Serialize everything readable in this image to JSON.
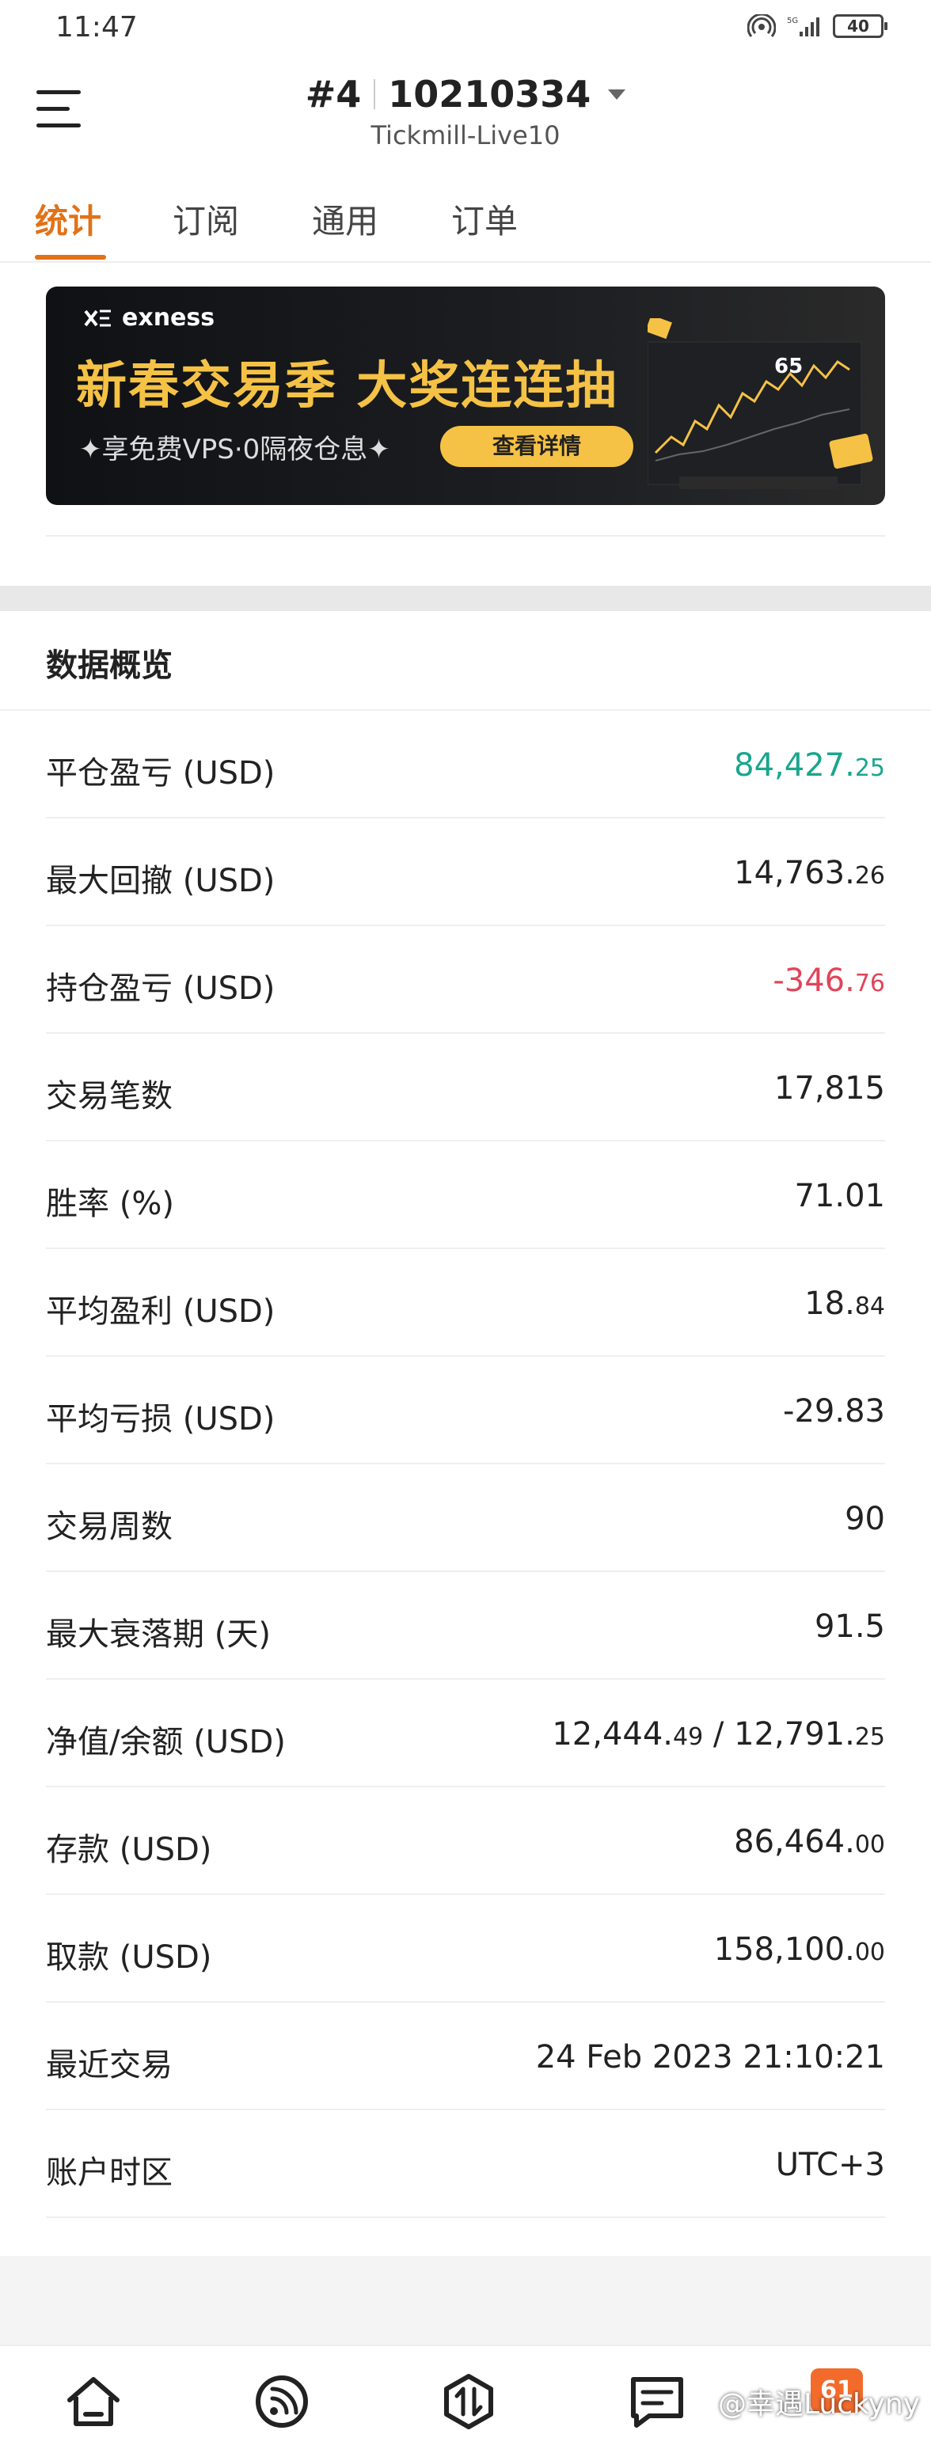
{
  "status_bar": {
    "time": "11:47",
    "battery": "40"
  },
  "header": {
    "account_prefix": "#4",
    "account_number": "10210334",
    "server": "Tickmill-Live10"
  },
  "tabs": [
    {
      "label": "统计",
      "active": true
    },
    {
      "label": "订阅",
      "active": false
    },
    {
      "label": "通用",
      "active": false
    },
    {
      "label": "订单",
      "active": false
    }
  ],
  "banner": {
    "brand": "exness",
    "title": "新春交易季 大奖连连抽",
    "subtitle": "✦享免费VPS·0隔夜仓息✦",
    "button": "查看详情",
    "badge_number": "65"
  },
  "overview": {
    "title": "数据概览",
    "rows": [
      {
        "label": "平仓盈亏 (USD)",
        "int": "84,427.",
        "dec": "25",
        "tone": "pos"
      },
      {
        "label": "最大回撤 (USD)",
        "int": "14,763.",
        "dec": "26",
        "tone": ""
      },
      {
        "label": "持仓盈亏 (USD)",
        "int": "-346.",
        "dec": "76",
        "tone": "neg"
      },
      {
        "label": "交易笔数",
        "int": "17,815",
        "dec": "",
        "tone": ""
      },
      {
        "label": "胜率 (%)",
        "int": "71.01",
        "dec": "",
        "tone": ""
      },
      {
        "label": "平均盈利 (USD)",
        "int": "18.",
        "dec": "84",
        "tone": ""
      },
      {
        "label": "平均亏损 (USD)",
        "int": "-29.83",
        "dec": "",
        "tone": ""
      },
      {
        "label": "交易周数",
        "int": "90",
        "dec": "",
        "tone": ""
      },
      {
        "label": "最大衰落期 (天)",
        "int": "91.5",
        "dec": "",
        "tone": ""
      },
      {
        "label": "净值/余额 (USD)",
        "int": "12,444.",
        "dec": "49",
        "int2": " / 12,791.",
        "dec2": "25",
        "tone": ""
      },
      {
        "label": "存款 (USD)",
        "int": "86,464.",
        "dec": "00",
        "tone": ""
      },
      {
        "label": "取款 (USD)",
        "int": "158,100.",
        "dec": "00",
        "tone": ""
      },
      {
        "label": "最近交易",
        "int": "24 Feb 2023 21:10:21",
        "dec": "",
        "tone": ""
      },
      {
        "label": "账户时区",
        "int": "UTC+3",
        "dec": "",
        "tone": ""
      }
    ]
  },
  "bottom_nav": {
    "items": [
      "home-icon",
      "feed-icon",
      "trade-icon",
      "messages-icon"
    ],
    "watermark": "@幸遇Luckyny",
    "badge": "61"
  },
  "colors": {
    "accent": "#e27217",
    "positive": "#1aa68d",
    "negative": "#e0455a",
    "banner_gold": "#f5c245"
  }
}
